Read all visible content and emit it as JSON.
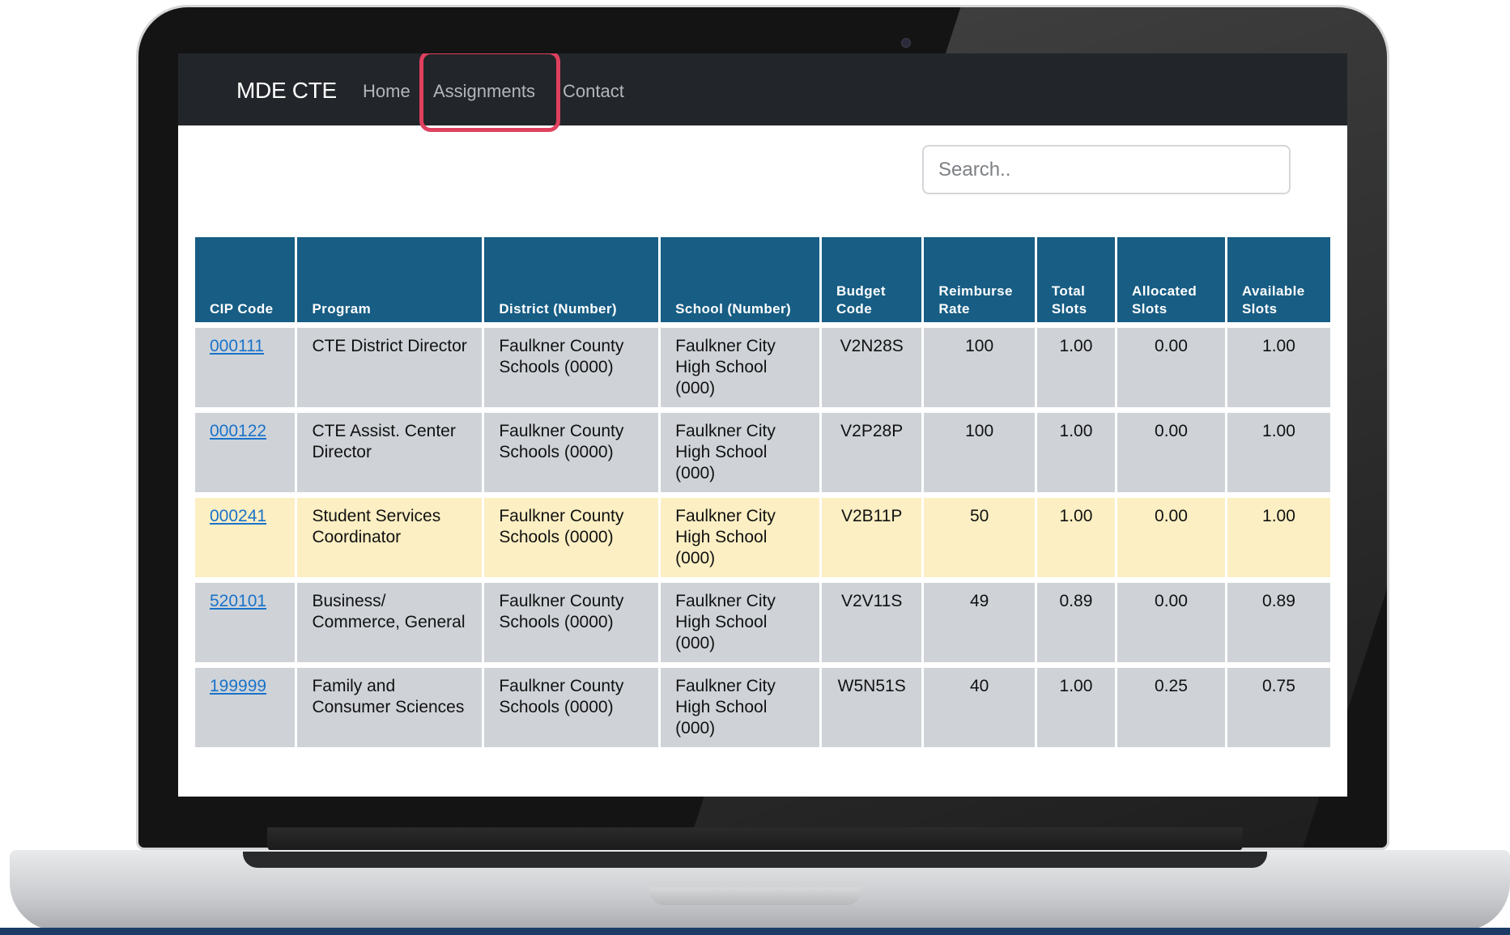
{
  "navbar": {
    "brand": "MDE CTE",
    "links": [
      {
        "label": "Home"
      },
      {
        "label": "Assignments"
      },
      {
        "label": "Contact"
      }
    ]
  },
  "search": {
    "placeholder": "Search.."
  },
  "table": {
    "headers": [
      "CIP Code",
      "Program",
      "District (Number)",
      "School (Number)",
      "Budget Code",
      "Reimburse Rate",
      "Total Slots",
      "Allocated Slots",
      "Available Slots"
    ],
    "rows": [
      {
        "cip": "000111",
        "program": "CTE District Director",
        "district": "Faulkner County Schools (0000)",
        "school": "Faulkner City High School (000)",
        "budget": "V2N28S",
        "rate": "100",
        "total": "1.00",
        "allocated": "0.00",
        "available": "1.00"
      },
      {
        "cip": "000122",
        "program": "CTE Assist. Center Director",
        "district": "Faulkner County Schools (0000)",
        "school": "Faulkner City High School (000)",
        "budget": "V2P28P",
        "rate": "100",
        "total": "1.00",
        "allocated": "0.00",
        "available": "1.00"
      },
      {
        "cip": "000241",
        "program": "Student Services Coordinator",
        "district": "Faulkner County Schools (0000)",
        "school": "Faulkner City High School (000)",
        "budget": "V2B11P",
        "rate": "50",
        "total": "1.00",
        "allocated": "0.00",
        "available": "1.00"
      },
      {
        "cip": "520101",
        "program": "Business/ Commerce, General",
        "district": "Faulkner County Schools (0000)",
        "school": "Faulkner City High School (000)",
        "budget": "V2V11S",
        "rate": "49",
        "total": "0.89",
        "allocated": "0.00",
        "available": "0.89"
      },
      {
        "cip": "199999",
        "program": "Family and Consumer Sciences",
        "district": "Faulkner County Schools (0000)",
        "school": "Faulkner City High School (000)",
        "budget": "W5N51S",
        "rate": "40",
        "total": "1.00",
        "allocated": "0.25",
        "available": "0.75"
      }
    ]
  },
  "colors": {
    "navbar_bg": "#222529",
    "header_bg": "#175d84",
    "row_bg": "#cfd3d8",
    "selected_row_bg": "#fcefc3",
    "highlight": "#e0405f",
    "link": "#1a73c9"
  }
}
